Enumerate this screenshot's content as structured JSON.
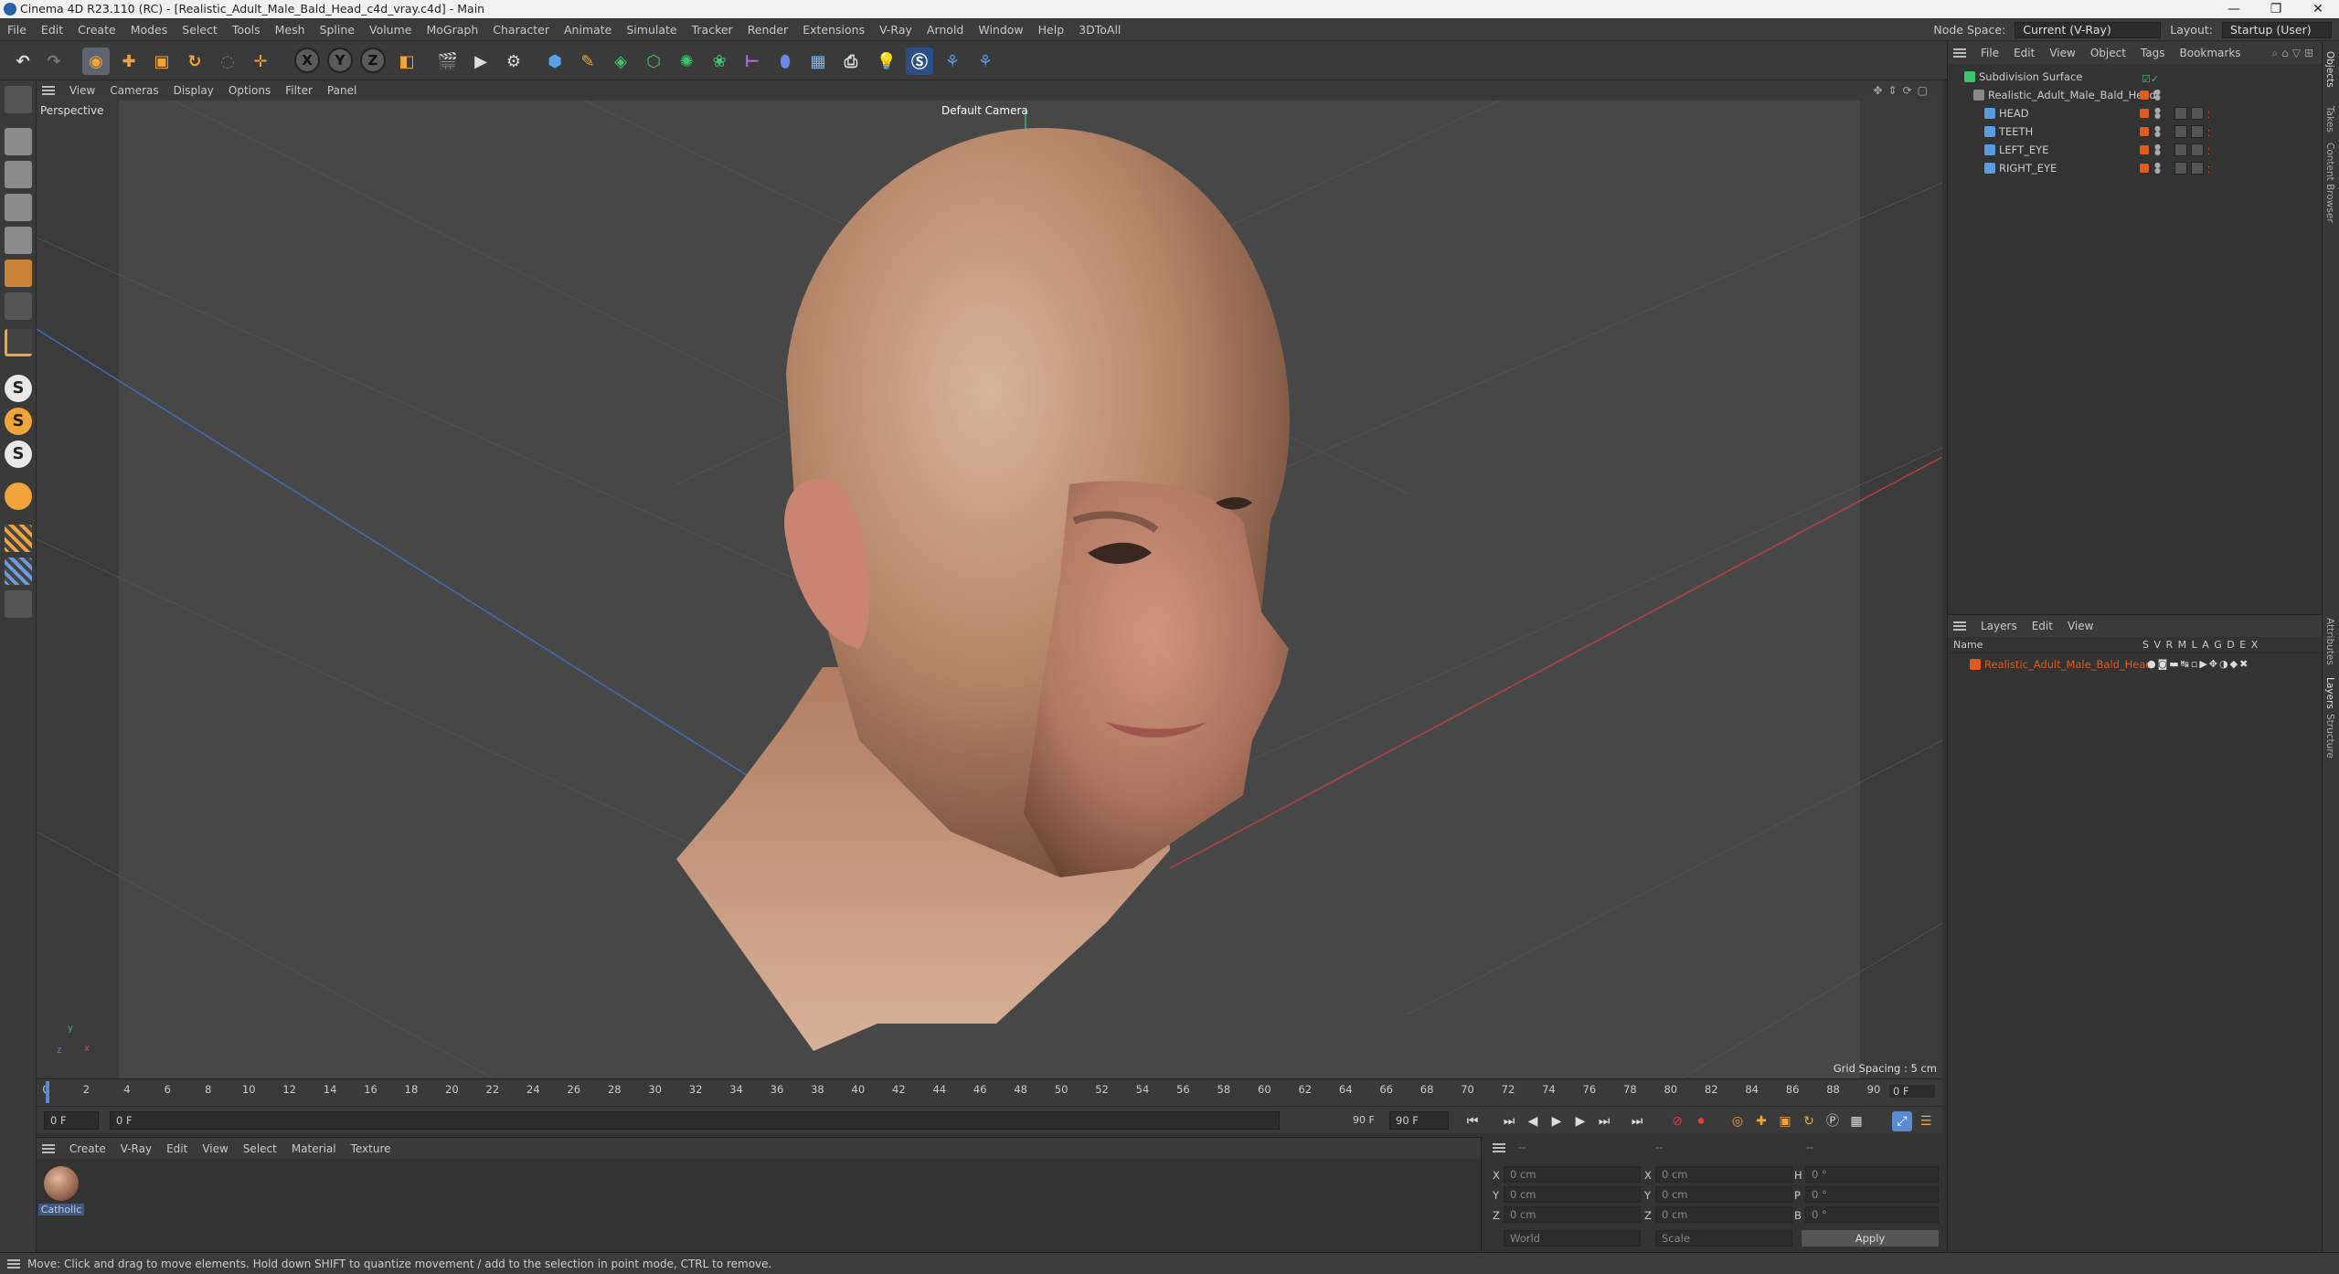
{
  "window": {
    "title": "Cinema 4D R23.110 (RC) - [Realistic_Adult_Male_Bald_Head_c4d_vray.c4d] - Main",
    "controls": [
      "—",
      "❐",
      "✕"
    ]
  },
  "menubar": {
    "items": [
      "File",
      "Edit",
      "Create",
      "Modes",
      "Select",
      "Tools",
      "Mesh",
      "Spline",
      "Volume",
      "MoGraph",
      "Character",
      "Animate",
      "Simulate",
      "Tracker",
      "Render",
      "Extensions",
      "V-Ray",
      "Arnold",
      "Window",
      "Help",
      "3DToAll"
    ],
    "node_space_label": "Node Space:",
    "node_space_value": "Current (V-Ray)",
    "layout_label": "Layout:",
    "layout_value": "Startup (User)"
  },
  "toolbar": {
    "axis_x": "X",
    "axis_y": "Y",
    "axis_z": "Z"
  },
  "left_toolbar": {
    "s1": "S",
    "s2": "S",
    "s3": "S"
  },
  "viewport_menu": {
    "items": [
      "View",
      "Cameras",
      "Display",
      "Options",
      "Filter",
      "Panel"
    ]
  },
  "viewport": {
    "mode": "Perspective",
    "camera": "Default Camera",
    "grid_spacing": "Grid Spacing : 5 cm",
    "axis_y": "y",
    "axis_x": "x",
    "axis_z": "z"
  },
  "timeline": {
    "ticks": [
      "0",
      "2",
      "4",
      "6",
      "8",
      "10",
      "12",
      "14",
      "16",
      "18",
      "20",
      "22",
      "24",
      "26",
      "28",
      "30",
      "32",
      "34",
      "36",
      "38",
      "40",
      "42",
      "44",
      "46",
      "48",
      "50",
      "52",
      "54",
      "56",
      "58",
      "60",
      "62",
      "64",
      "66",
      "68",
      "70",
      "72",
      "74",
      "76",
      "78",
      "80",
      "82",
      "84",
      "86",
      "88",
      "90"
    ],
    "current_frame": "0 F"
  },
  "playbar": {
    "start": "0 F",
    "range_start": "0 F",
    "range_end": "90 F",
    "end": "90 F"
  },
  "material_menu": {
    "items": [
      "Create",
      "V-Ray",
      "Edit",
      "View",
      "Select",
      "Material",
      "Texture"
    ]
  },
  "materials": [
    {
      "name": "Catholic"
    }
  ],
  "coords": {
    "header_left": "--",
    "header_mid": "--",
    "header_right": "--",
    "rows": [
      {
        "l1": "X",
        "v1": "0 cm",
        "l2": "X",
        "v2": "0 cm",
        "l3": "H",
        "v3": "0 °"
      },
      {
        "l1": "Y",
        "v1": "0 cm",
        "l2": "Y",
        "v2": "0 cm",
        "l3": "P",
        "v3": "0 °"
      },
      {
        "l1": "Z",
        "v1": "0 cm",
        "l2": "Z",
        "v2": "0 cm",
        "l3": "B",
        "v3": "0 °"
      }
    ],
    "coord_mode": "World",
    "size_mode": "Scale",
    "apply_label": "Apply"
  },
  "status": {
    "text": "Move: Click and drag to move elements. Hold down SHIFT to quantize movement / add to the selection in point mode, CTRL to remove."
  },
  "object_manager": {
    "menu": [
      "File",
      "Edit",
      "View",
      "Object",
      "Tags",
      "Bookmarks"
    ],
    "objects": [
      {
        "name": "Subdivision Surface",
        "indent": 0
      },
      {
        "name": "Realistic_Adult_Male_Bald_Head",
        "indent": 1
      },
      {
        "name": "HEAD",
        "indent": 2
      },
      {
        "name": "TEETH",
        "indent": 2
      },
      {
        "name": "LEFT_EYE",
        "indent": 2
      },
      {
        "name": "RIGHT_EYE",
        "indent": 2
      }
    ]
  },
  "layer_manager": {
    "menu": [
      "Layers",
      "Edit",
      "View"
    ],
    "col_name": "Name",
    "col_flags": "S V R M L A G D E X",
    "layers": [
      {
        "name": "Realistic_Adult_Male_Bald_Head",
        "color": "#e25a1c"
      }
    ]
  },
  "right_tabs": [
    "Objects",
    "Takes",
    "Content Browser",
    "Attributes",
    "Layers",
    "Structure"
  ],
  "colors": {
    "accent": "#e25a1c",
    "selection": "#3d5a87"
  }
}
